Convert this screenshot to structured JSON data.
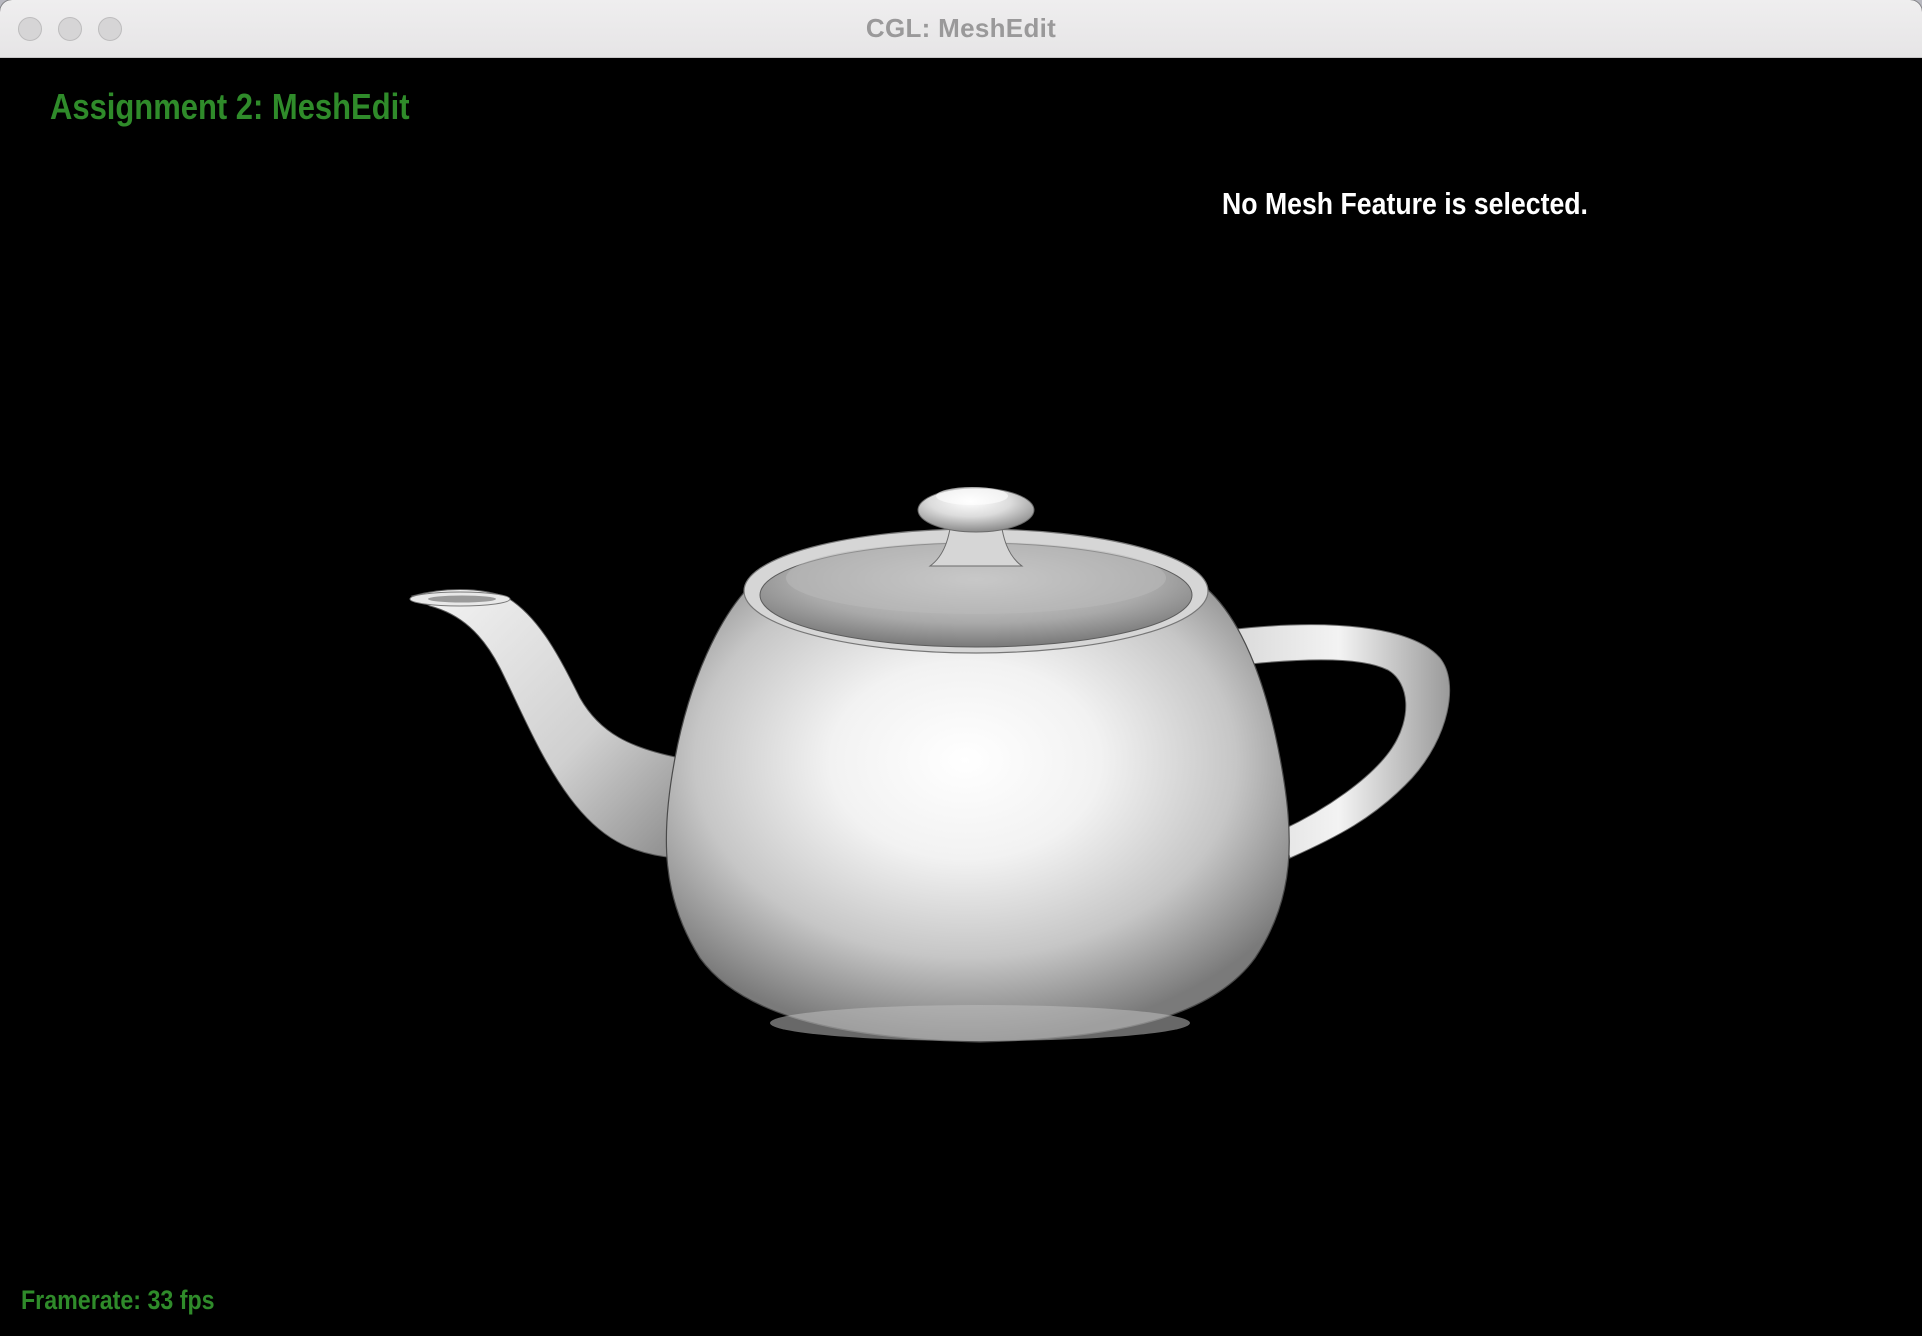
{
  "window": {
    "title": "CGL: MeshEdit"
  },
  "overlay": {
    "app_title": "Assignment 2: MeshEdit",
    "status_message": "No Mesh Feature is selected.",
    "framerate_label": "Framerate: 33 fps"
  },
  "colors": {
    "overlay_green": "#2f8b2a",
    "status_white": "#ffffff",
    "viewport_background": "#000000"
  },
  "icons": {
    "close": "close-dot-icon",
    "minimize": "minimize-dot-icon",
    "maximize": "maximize-dot-icon"
  }
}
